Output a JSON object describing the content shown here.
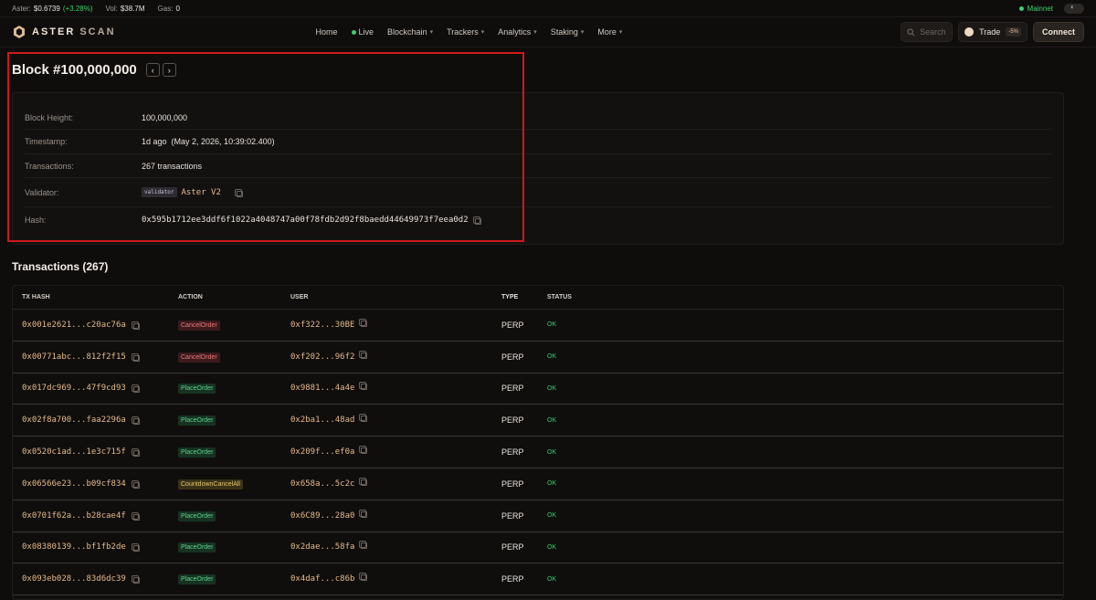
{
  "ticker": {
    "aster_label": "Aster:",
    "aster_price": "$0.6739",
    "aster_change": "(+3.28%)",
    "vol_label": "Vol:",
    "vol_value": "$38.7M",
    "gas_label": "Gas:",
    "gas_value": "0",
    "network": "Mainnet"
  },
  "nav": {
    "logo_a": "ASTER",
    "logo_b": "SCAN",
    "links": [
      "Home",
      "Live",
      "Blockchain",
      "Trackers",
      "Analytics",
      "Staking",
      "More"
    ],
    "search_placeholder": "Search",
    "trade_label": "Trade",
    "trade_badge": "-5%",
    "connect_label": "Connect"
  },
  "block": {
    "title": "Block #100,000,000",
    "prev_icon": "‹",
    "next_icon": "›",
    "details": {
      "height_label": "Block Height:",
      "height_value": "100,000,000",
      "timestamp_label": "Timestamp:",
      "timestamp_value": "1d ago  (May 2, 2026, 10:39:02.400)",
      "transactions_label": "Transactions:",
      "transactions_value": "267 transactions",
      "validator_label": "Validator:",
      "validator_tag": "validator",
      "validator_name": "Aster V2",
      "hash_label": "Hash:",
      "hash_value": "0x595b1712ee3ddf6f1022a4048747a00f78fdb2d92f8baedd44649973f7eea0d2"
    }
  },
  "transactions": {
    "title": "Transactions (267)",
    "columns": [
      "TX HASH",
      "ACTION",
      "USER",
      "TYPE",
      "STATUS"
    ],
    "rows": [
      {
        "hash": "0x001e2621...c20ac76a",
        "action": "CancelOrder",
        "kind": "cancel",
        "user": "0xf322...30BE",
        "type": "PERP",
        "status": "OK"
      },
      {
        "hash": "0x00771abc...812f2f15",
        "action": "CancelOrder",
        "kind": "cancel",
        "user": "0xf202...96f2",
        "type": "PERP",
        "status": "OK"
      },
      {
        "hash": "0x017dc969...47f9cd93",
        "action": "PlaceOrder",
        "kind": "place",
        "user": "0x9881...4a4e",
        "type": "PERP",
        "status": "OK"
      },
      {
        "hash": "0x02f8a700...faa2296a",
        "action": "PlaceOrder",
        "kind": "place",
        "user": "0x2ba1...48ad",
        "type": "PERP",
        "status": "OK"
      },
      {
        "hash": "0x0520c1ad...1e3c715f",
        "action": "PlaceOrder",
        "kind": "place",
        "user": "0x209f...ef0a",
        "type": "PERP",
        "status": "OK"
      },
      {
        "hash": "0x06566e23...b09cf834",
        "action": "CountdownCancelAll",
        "kind": "countdown",
        "user": "0x658a...5c2c",
        "type": "PERP",
        "status": "OK"
      },
      {
        "hash": "0x0701f62a...b28cae4f",
        "action": "PlaceOrder",
        "kind": "place",
        "user": "0x6C89...28a0",
        "type": "PERP",
        "status": "OK"
      },
      {
        "hash": "0x08380139...bf1fb2de",
        "action": "PlaceOrder",
        "kind": "place",
        "user": "0x2dae...58fa",
        "type": "PERP",
        "status": "OK"
      },
      {
        "hash": "0x093eb028...83d6dc39",
        "action": "PlaceOrder",
        "kind": "place",
        "user": "0x4daf...c86b",
        "type": "PERP",
        "status": "OK"
      }
    ]
  },
  "colors": {
    "accent": "#e4b98a",
    "ok": "#3ccf6a",
    "highlight": "#d0181b"
  }
}
